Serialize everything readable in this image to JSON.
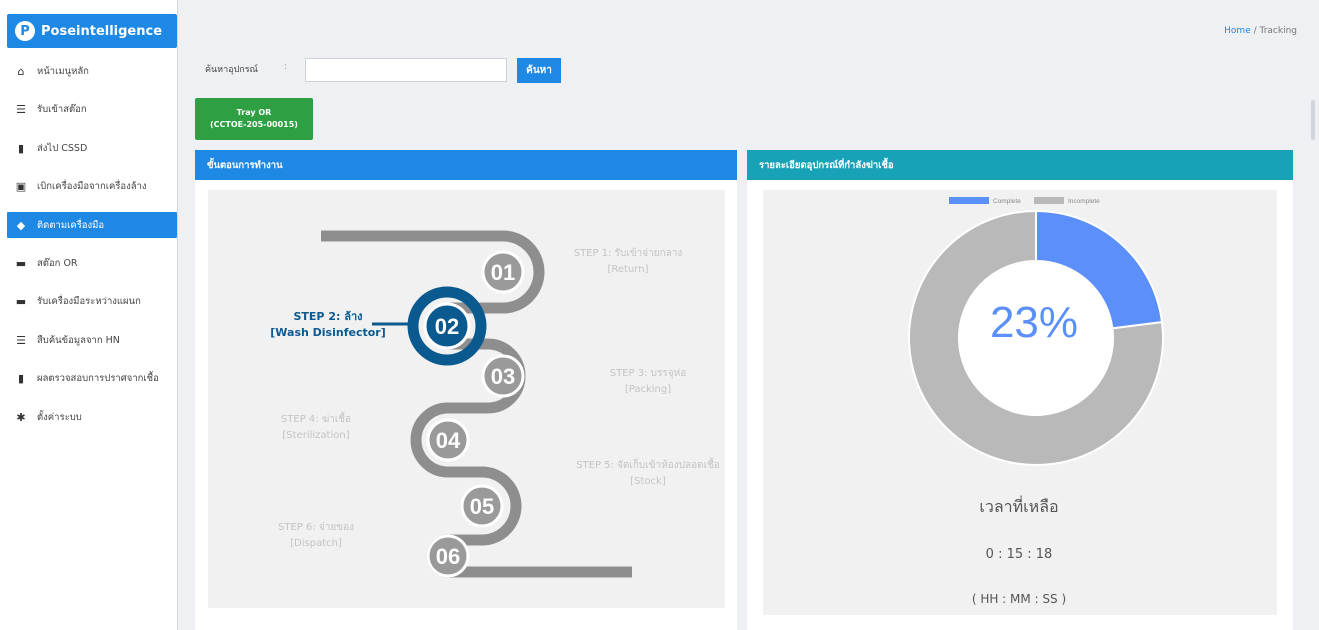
{
  "brand": {
    "logo_letter": "P",
    "name": "Poseintelligence"
  },
  "sidebar": {
    "items": [
      {
        "label": "หน้าเมนูหลัก",
        "icon": "home-icon",
        "glyph": "⌂",
        "active": false
      },
      {
        "label": "รับเข้าสต๊อก",
        "icon": "list-icon",
        "glyph": "☰",
        "active": false
      },
      {
        "label": "ส่งไป CSSD",
        "icon": "file-icon",
        "glyph": "▮",
        "active": false
      },
      {
        "label": "เบิกเครื่องมือจากเครื่องล้าง",
        "icon": "window-icon",
        "glyph": "▣",
        "active": false
      },
      {
        "label": "ติดตามเครื่องมือ",
        "icon": "tag-icon",
        "glyph": "◆",
        "active": true
      },
      {
        "label": "สต๊อก OR",
        "icon": "folder-icon",
        "glyph": "▬",
        "active": false
      },
      {
        "label": "รับเครื่องมือระหว่างแผนก",
        "icon": "briefcase-icon",
        "glyph": "▬",
        "active": false
      },
      {
        "label": "สืบค้นข้อมูลจาก HN",
        "icon": "list-icon",
        "glyph": "☰",
        "active": false
      },
      {
        "label": "ผลตรวจสอบการปราศจากเชื้อ",
        "icon": "document-icon",
        "glyph": "▮",
        "active": false
      },
      {
        "label": "ตั้งค่าระบบ",
        "icon": "gear-icon",
        "glyph": "✱",
        "active": false
      }
    ]
  },
  "breadcrumb": {
    "home": "Home",
    "separator": "/",
    "current": "Tracking"
  },
  "search": {
    "label": "ค้นหาอุปกรณ์",
    "colon": ":",
    "value": "",
    "placeholder": "",
    "button": "ค้นหา"
  },
  "tray": {
    "line1": "Tray OR",
    "line2": "(CCTOE-205-00015)"
  },
  "steps_card": {
    "title": "ขั้นตอนการทำงาน",
    "steps": [
      {
        "num": "01",
        "label": "STEP 1: รับเข้าจ่ายกลาง",
        "sub": "[Return]",
        "active": false
      },
      {
        "num": "02",
        "label": "STEP 2: ล้าง",
        "sub": "[Wash Disinfector]",
        "active": true
      },
      {
        "num": "03",
        "label": "STEP 3: บรรจุห่อ",
        "sub": "[Packing]",
        "active": false
      },
      {
        "num": "04",
        "label": "STEP 4: ฆ่าเชื้อ",
        "sub": "[Sterilization]",
        "active": false
      },
      {
        "num": "05",
        "label": "STEP 5: จัดเก็บเข้าห้องปลอดเชื้อ",
        "sub": "[Stock]",
        "active": false
      },
      {
        "num": "06",
        "label": "STEP 6: จ่ายของ",
        "sub": "[Dispatch]",
        "active": false
      }
    ]
  },
  "donut_card": {
    "title": "รายละเอียดอุปกรณ์ที่กำลังฆ่าเชื้อ",
    "legend": {
      "complete": "Complete",
      "incomplete": "Incomplete"
    },
    "percent_label": "23%",
    "time_title": "เวลาที่เหลือ",
    "time_value": "0 : 15 : 18",
    "time_format": "( HH : MM : SS )"
  },
  "chart_data": {
    "type": "pie",
    "categories": [
      "Complete",
      "Incomplete"
    ],
    "values": [
      23,
      77
    ],
    "colors": [
      "#5b8ff9",
      "#b9b9b9"
    ],
    "legend": "top"
  },
  "colors": {
    "accent": "#1e88e5",
    "teal": "#17a2b8",
    "green": "#2ea043",
    "active_step": "#0b5a8f",
    "inactive_step": "#9a9a9a"
  }
}
